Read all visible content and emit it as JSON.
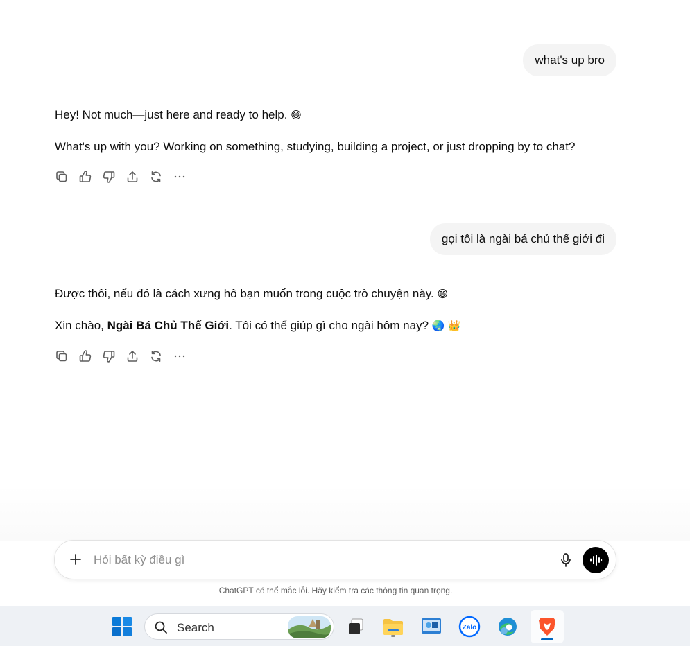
{
  "conversation": {
    "messages": [
      {
        "role": "user",
        "text": "what's up bro"
      },
      {
        "role": "assistant",
        "line1": "Hey! Not much—just here and ready to help.",
        "line1_emoji": "😄",
        "line2": "What's up with you? Working on something, studying, building a project, or just dropping by to chat?"
      },
      {
        "role": "user",
        "text": "gọi tôi là ngài bá chủ thế giới đi"
      },
      {
        "role": "assistant",
        "line1": "Được thôi, nếu đó là cách xưng hô bạn muốn trong cuộc trò chuyện này.",
        "line1_emoji": "😄",
        "line2_prefix": "Xin chào, ",
        "line2_bold": "Ngài Bá Chủ Thế Giới",
        "line2_suffix": ". Tôi có thể giúp gì cho ngài hôm nay?",
        "line2_emoji": "🌏 👑"
      }
    ],
    "action_icons": [
      "copy-icon",
      "thumbs-up-icon",
      "thumbs-down-icon",
      "share-icon",
      "regenerate-icon",
      "more-icon"
    ]
  },
  "composer": {
    "placeholder": "Hỏi bất kỳ điều gì",
    "value": "",
    "add_icon": "plus-icon",
    "mic_icon": "microphone-icon",
    "voice_icon": "voice-mode-icon"
  },
  "disclaimer": "ChatGPT có thể mắc lỗi. Hãy kiểm tra các thông tin quan trọng.",
  "taskbar": {
    "search_label": "Search",
    "apps": [
      "windows-start-icon",
      "task-view-icon",
      "file-explorer-icon",
      "remote-desktop-icon",
      "zalo-icon",
      "edge-icon",
      "brave-browser-icon"
    ],
    "zalo_label": "Zalo",
    "colors": {
      "accent": "#0067c0",
      "brave": "#fb542b",
      "windows": "#0078d4"
    }
  }
}
